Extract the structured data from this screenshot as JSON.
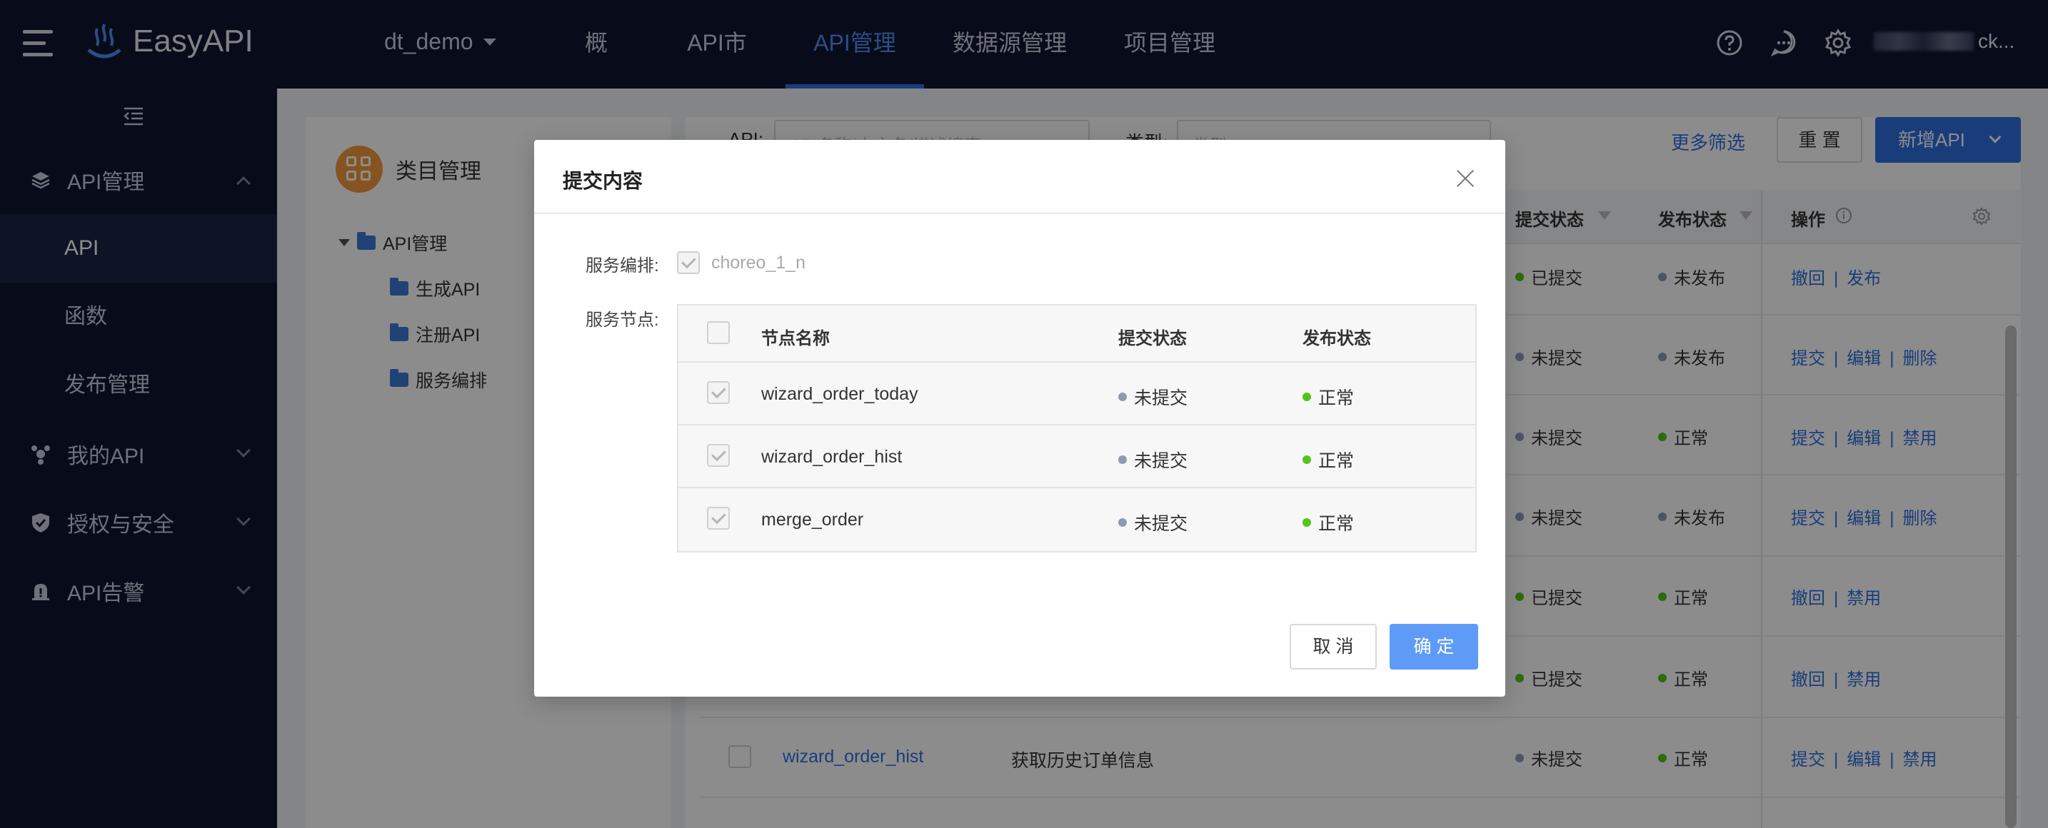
{
  "topnav": {
    "brand": "EasyAPI",
    "project": "dt_demo",
    "tabs": [
      {
        "label": "概览"
      },
      {
        "label": "API市场"
      },
      {
        "label": "API管理"
      },
      {
        "label": "数据源管理"
      },
      {
        "label": "项目管理"
      }
    ],
    "active_tab": "API管理",
    "user_suffix": "ck..."
  },
  "sidebar": {
    "groups": [
      {
        "label": "API管理"
      },
      {
        "label": "我的API"
      },
      {
        "label": "授权与安全"
      },
      {
        "label": "API告警"
      }
    ],
    "items": [
      {
        "label": "API"
      },
      {
        "label": "函数"
      },
      {
        "label": "发布管理"
      }
    ]
  },
  "category": {
    "title": "类目管理",
    "root": "API管理",
    "children": [
      "生成API",
      "注册API",
      "服务编排"
    ]
  },
  "filters": {
    "api_label": "API:",
    "api_placeholder": "API名称/中文名/描述搜索",
    "type_label": "类型:",
    "type_placeholder": "类型",
    "more": "更多筛选",
    "reset": "重 置",
    "add": "新增API"
  },
  "table": {
    "headers": {
      "submit_status": "提交状态",
      "publish_status": "发布状态",
      "ops": "操作"
    },
    "rows": [
      {
        "submit": "已提交",
        "publish": "未发布",
        "ops": [
          "撤回",
          "发布"
        ]
      },
      {
        "submit": "未提交",
        "publish": "未发布",
        "ops": [
          "提交",
          "编辑",
          "删除"
        ]
      },
      {
        "submit": "未提交",
        "publish": "正常",
        "ops": [
          "提交",
          "编辑",
          "禁用"
        ]
      },
      {
        "submit": "未提交",
        "publish": "未发布",
        "ops": [
          "提交",
          "编辑",
          "删除"
        ]
      },
      {
        "submit": "已提交",
        "publish": "正常",
        "ops": [
          "撤回",
          "禁用"
        ]
      },
      {
        "submit": "已提交",
        "publish": "正常",
        "ops": [
          "撤回",
          "禁用"
        ]
      },
      {
        "name": "wizard_order_hist",
        "desc": "获取历史订单信息",
        "submit": "未提交",
        "publish": "正常",
        "ops": [
          "提交",
          "编辑",
          "禁用"
        ]
      }
    ]
  },
  "modal": {
    "title": "提交内容",
    "service_label": "服务编排:",
    "service_value": "choreo_1_n",
    "nodes_label": "服务节点:",
    "headers": {
      "name": "节点名称",
      "submit": "提交状态",
      "publish": "发布状态"
    },
    "nodes": [
      {
        "name": "wizard_order_today",
        "submit": "未提交",
        "publish": "正常"
      },
      {
        "name": "wizard_order_hist",
        "submit": "未提交",
        "publish": "正常"
      },
      {
        "name": "merge_order",
        "submit": "未提交",
        "publish": "正常"
      }
    ],
    "cancel": "取 消",
    "ok": "确 定"
  },
  "colors": {
    "nav_bg": "#0f1630",
    "accent": "#2f6fe0",
    "ok_button": "#5e9bf7",
    "status_green": "#52c41a",
    "status_gray": "#8c9bb3",
    "category_logo": "#f39a3d"
  },
  "icons": [
    "menu-icon",
    "logo-icon",
    "help-icon",
    "message-icon",
    "settings-icon",
    "collapse-icon",
    "layers-icon",
    "my-api-icon",
    "shield-icon",
    "alarm-icon",
    "folder-icon",
    "filter-icon",
    "info-icon",
    "gear-icon",
    "close-icon",
    "check-icon"
  ]
}
